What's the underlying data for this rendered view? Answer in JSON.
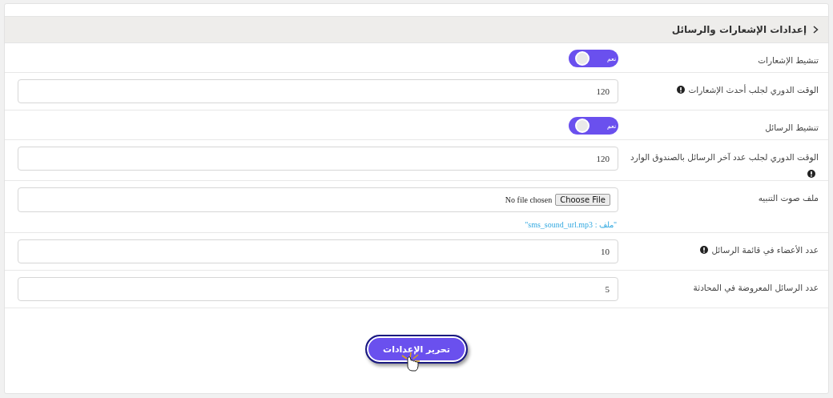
{
  "panel": {
    "title": "إعدادات الإشعارات والرسائل",
    "expanded": true
  },
  "rows": [
    {
      "kind": "toggle",
      "label": "تنشيط الإشعارات",
      "on": true,
      "toggle_text": "نعم"
    },
    {
      "kind": "input",
      "label": "الوقت الدوري لجلب أحدث الإشعارات",
      "info": true,
      "value": "120"
    },
    {
      "kind": "toggle",
      "label": "تنشيط الرسائل",
      "on": true,
      "toggle_text": "نعم"
    },
    {
      "kind": "input",
      "label": "الوقت الدوري لجلب عدد آخر الرسائل بالصندوق الوارد",
      "info": true,
      "value": "120"
    },
    {
      "kind": "file",
      "label": "ملف صوت التنبيه",
      "button": "Choose File",
      "status": "No file chosen",
      "note": "\"ملف : sms_sound_url.mp3\""
    },
    {
      "kind": "input",
      "label": "عدد الأعضاء في قائمة الرسائل",
      "info": true,
      "value": "10"
    },
    {
      "kind": "input",
      "label": "عدد الرسائل المعروضة في المحادثة",
      "info": false,
      "value": "5"
    }
  ],
  "submit": {
    "label": "تحرير الإعدادات"
  }
}
